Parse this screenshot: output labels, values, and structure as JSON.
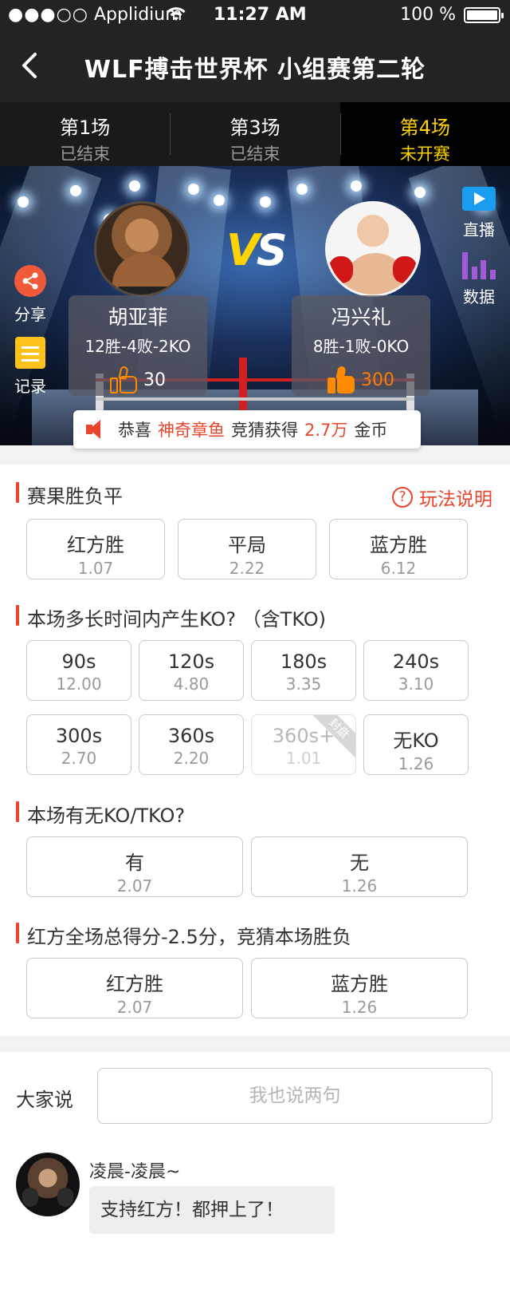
{
  "status_bar": {
    "carrier_dots": "●●●○○",
    "carrier": "Applidium",
    "time": "11:27 AM",
    "battery": "100 %"
  },
  "header": {
    "title": "WLF搏击世界杯 小组赛第二轮"
  },
  "tabs": [
    {
      "name": "第1场",
      "status": "已结束"
    },
    {
      "name": "第3场",
      "status": "已结束"
    },
    {
      "name": "第4场",
      "status": "未开赛"
    }
  ],
  "arena": {
    "vs_v": "V",
    "vs_s": "S",
    "share_label": "分享",
    "record_label": "记录",
    "live_label": "直播",
    "data_label": "数据",
    "red_fighter": {
      "name": "胡亚菲",
      "record": "12胜-4败-2KO",
      "likes": "30"
    },
    "blue_fighter": {
      "name": "冯兴礼",
      "record": "8胜-1败-0KO",
      "likes": "300"
    }
  },
  "ticker": {
    "prefix": "恭喜",
    "user": "神奇章鱼",
    "middle": "竞猜获得",
    "amount": "2.7万",
    "suffix": "金币"
  },
  "bets": {
    "help_label": "玩法说明",
    "help_icon": "?",
    "sections": [
      {
        "title": "赛果胜负平",
        "options": [
          {
            "label": "红方胜",
            "odds": "1.07"
          },
          {
            "label": "平局",
            "odds": "2.22"
          },
          {
            "label": "蓝方胜",
            "odds": "6.12"
          }
        ]
      },
      {
        "title": "本场多长时间内产生KO? （含TKO)",
        "options": [
          {
            "label": "90s",
            "odds": "12.00"
          },
          {
            "label": "120s",
            "odds": "4.80"
          },
          {
            "label": "180s",
            "odds": "3.35"
          },
          {
            "label": "240s",
            "odds": "3.10"
          },
          {
            "label": "300s",
            "odds": "2.70"
          },
          {
            "label": "360s",
            "odds": "2.20"
          },
          {
            "label": "360s+",
            "odds": "1.01",
            "badge": "封盘"
          },
          {
            "label": "无KO",
            "odds": "1.26"
          }
        ]
      },
      {
        "title": "本场有无KO/TKO?",
        "options": [
          {
            "label": "有",
            "odds": "2.07"
          },
          {
            "label": "无",
            "odds": "1.26"
          }
        ]
      },
      {
        "title": "红方全场总得分-2.5分，竞猜本场胜负",
        "options": [
          {
            "label": "红方胜",
            "odds": "2.07"
          },
          {
            "label": "蓝方胜",
            "odds": "1.26"
          }
        ]
      }
    ]
  },
  "comments": {
    "label": "大家说",
    "placeholder": "我也说两句",
    "items": [
      {
        "user": "凌晨-凌晨~",
        "text": "支持红方！都押上了！"
      }
    ]
  },
  "colors": {
    "accent": "#e8452c",
    "active_tab": "#ffd400",
    "like_orange": "#ff7a00"
  }
}
